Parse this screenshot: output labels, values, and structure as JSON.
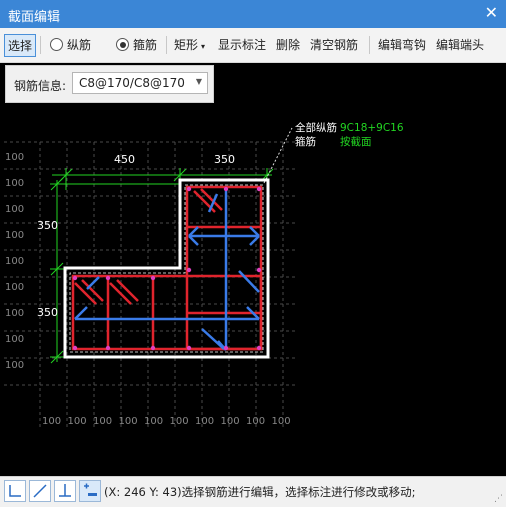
{
  "window": {
    "title": "截面编辑"
  },
  "toolbar": {
    "select": "选择",
    "longitudinal": "纵筋",
    "stirrup": "箍筋",
    "shape": "矩形",
    "show_annotation": "显示标注",
    "delete": "删除",
    "clear_rebar": "清空钢筋",
    "edit_hook": "编辑弯钩",
    "edit_end": "编辑端头"
  },
  "rebar_info": {
    "label": "钢筋信息:",
    "value": "C8@170/C8@170"
  },
  "drawing": {
    "legend_all_label": "全部纵筋",
    "legend_all_value": "9C18+9C16",
    "legend_stirrup_label": "箍筋",
    "legend_stirrup_value": "按截面",
    "dim_top_left": "450",
    "dim_top_right": "350",
    "dim_left_upper": "350",
    "dim_left_lower": "350",
    "grid_label": "100",
    "colors": {
      "outline": "#ffffff",
      "stirrup": "#e0242d",
      "tie": "#3a7be8",
      "dimension": "#22d422",
      "grid": "#4a4a4a",
      "legend_value": "#22d422"
    }
  },
  "status": {
    "coords": "(X: 246 Y: 43)",
    "message": "选择钢筋进行编辑，选择标注进行修改或移动;"
  },
  "icons": [
    "snap-orthogonal-icon",
    "draw-line-icon",
    "angle-icon",
    "add-point-icon"
  ]
}
